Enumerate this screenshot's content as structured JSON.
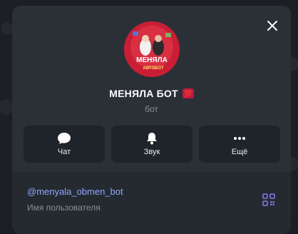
{
  "profile": {
    "name": "МЕНЯЛА БОТ",
    "badge": "💯",
    "subtitle": "бот",
    "avatar_text": "МЕНЯЛА",
    "avatar_subtext": "АВТОБОТ"
  },
  "actions": [
    {
      "label": "Чат",
      "icon": "chat-bubble-icon"
    },
    {
      "label": "Звук",
      "icon": "bell-icon"
    },
    {
      "label": "Ещё",
      "icon": "more-dots-icon"
    }
  ],
  "info": {
    "username": "@menyala_obmen_bot",
    "username_caption": "Имя пользователя"
  },
  "colors": {
    "panel": "#2b3037",
    "accent_link": "#8ea7ff",
    "qr_icon": "#7a6fd6"
  }
}
